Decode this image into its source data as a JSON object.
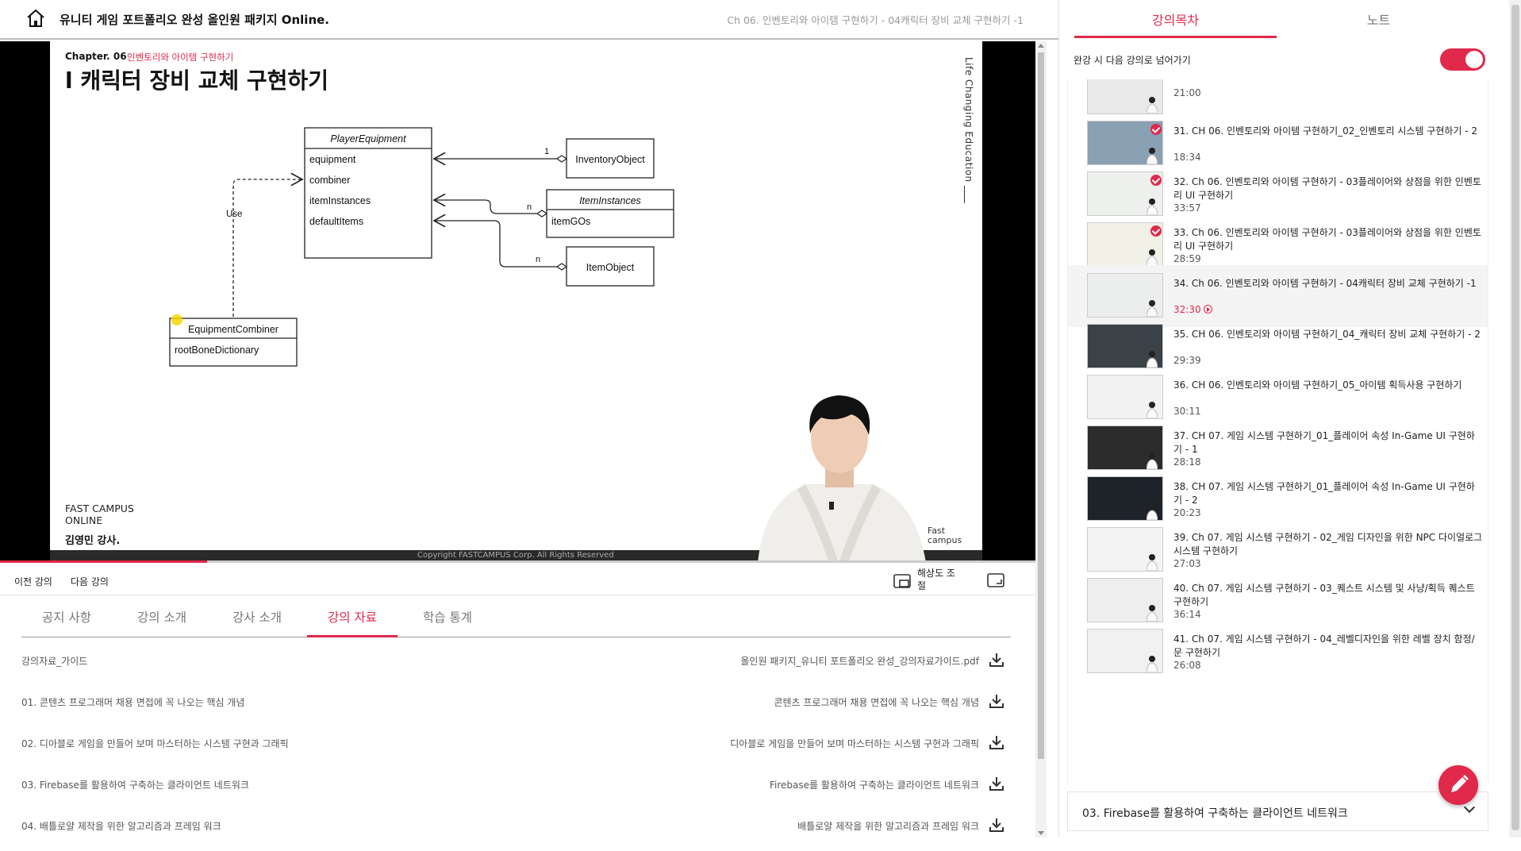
{
  "header": {
    "course_title": "유니티 게임 포트폴리오 완성 올인원 패키지 Online.",
    "lecture_title": "Ch 06. 인벤토리와 아이템 구현하기 - 04캐릭터 장비 교체 구현하기 -1",
    "home_icon": "home-icon"
  },
  "video": {
    "slide": {
      "chapter_label": "Chapter. 06",
      "chapter_name": "인벤토리와 아이템 구현하기",
      "heading": "l 캐릭터 장비 교체 구현하기",
      "side_text": "Life Changing Education",
      "brand_line1": "FAST CAMPUS",
      "brand_line2": "ONLINE",
      "instructor": "김영민 강사.",
      "brand_right1": "Fast",
      "brand_right2": "campus",
      "copyright": "Copyright FASTCAMPUS Corp. All Rights Reserved"
    },
    "diagram": {
      "player_equipment": {
        "title": "PlayerEquipment",
        "fields": [
          "equipment",
          "combiner",
          "itemInstances",
          "defaultItems"
        ]
      },
      "inventory_object": "InventoryObject",
      "item_instances": {
        "title": "ItemInstances",
        "fields": [
          "itemGOs"
        ]
      },
      "item_object": "ItemObject",
      "equipment_combiner": {
        "title": "EquipmentCombiner",
        "fields": [
          "rootBoneDictionary"
        ]
      },
      "use_label": "Use",
      "mult_1": "1",
      "mult_n1": "n",
      "mult_n2": "n"
    },
    "progress": 0.2
  },
  "controls": {
    "prev": "이전 강의",
    "next": "다음 강의",
    "resolution": "해상도 조절",
    "resolution_icon": "pip-icon",
    "fullscreen_icon": "fullscreen-icon"
  },
  "tabs": [
    {
      "label": "공지 사항",
      "active": false
    },
    {
      "label": "강의 소개",
      "active": false
    },
    {
      "label": "강사 소개",
      "active": false
    },
    {
      "label": "강의 자료",
      "active": true
    },
    {
      "label": "학습 통계",
      "active": false
    }
  ],
  "materials": [
    {
      "left": "강의자료_가이드",
      "right": "올인원 패키지_유니티 포트폴리오 완성_강의자료가이드.pdf"
    },
    {
      "left": "01. 콘텐츠 프로그래머 채용 면접에 꼭 나오는 핵심 개념",
      "right": "콘텐츠 프로그래머 채용 면접에 꼭 나오는 핵심 개념"
    },
    {
      "left": "02. 디아블로 게임을 만들어 보며 마스터하는 시스템 구현과 그래픽",
      "right": "디아블로 게임을 만들어 보며 마스터하는 시스템 구현과 그래픽"
    },
    {
      "left": "03. Firebase를 활용하여 구축하는 클라이언트 네트워크",
      "right": "Firebase를 활용하여 구축하는 클라이언트 네트워크"
    },
    {
      "left": "04. 배틀로얄 제작을 위한 알고리즘과 프레임 워크",
      "right": "배틀로얄 제작을 위한 알고리즘과 프레임 워크"
    }
  ],
  "rpanel": {
    "tabs": [
      {
        "label": "강의목차",
        "active": true
      },
      {
        "label": "노트",
        "active": false
      }
    ],
    "autoplay_label": "완강 시 다음 강의로 넘어가기",
    "autoplay_on": true,
    "items": [
      {
        "title": "",
        "duration": "21:00",
        "done": false,
        "current": false
      },
      {
        "title": "31. CH 06. 인벤토리와 아이템 구현하기_02_인벤토리 시스템 구현하기 - 2",
        "duration": "18:34",
        "done": true,
        "current": false
      },
      {
        "title": "32. Ch 06. 인벤토리와 아이템 구현하기 - 03플레이어와 상점을 위한 인벤토리 UI 구현하기",
        "duration": "33:57",
        "done": true,
        "current": false
      },
      {
        "title": "33. Ch 06. 인벤토리와 아이템 구현하기 - 03플레이어와 상점을 위한 인벤토리 UI 구현하기",
        "duration": "28:59",
        "done": true,
        "current": false
      },
      {
        "title": "34. Ch 06. 인벤토리와 아이템 구현하기 - 04캐릭터 장비 교체 구현하기 -1",
        "duration": "32:30",
        "done": false,
        "current": true
      },
      {
        "title": "35. CH 06. 인벤토리와 아이템 구현하기_04_캐릭터 장비 교체 구현하기 - 2",
        "duration": "29:39",
        "done": false,
        "current": false
      },
      {
        "title": "36. CH 06. 인벤토리와 아이템 구현하기_05_아이템 획득사용 구현하기",
        "duration": "30:11",
        "done": false,
        "current": false
      },
      {
        "title": "37. CH 07. 게임 시스템 구현하기_01_플레이어 속성 In-Game UI 구현하기 - 1",
        "duration": "28:18",
        "done": false,
        "current": false
      },
      {
        "title": "38. CH 07. 게임 시스템 구현하기_01_플레이어 속성 In-Game UI 구현하기 - 2",
        "duration": "20:23",
        "done": false,
        "current": false
      },
      {
        "title": "39. Ch 07. 게임 시스템 구현하기 - 02_게임 디자인을 위한 NPC 다이얼로그 시스템 구현하기",
        "duration": "27:03",
        "done": false,
        "current": false
      },
      {
        "title": "40. Ch 07. 게임 시스템 구현하기 - 03_퀘스트 시스템 및 사냥/획득 퀘스트 구현하기",
        "duration": "36:14",
        "done": false,
        "current": false
      },
      {
        "title": "41. Ch 07. 게임 시스템 구현하기 - 04_레벨디자인을 위한 레벨 장치 함정/문 구현하기",
        "duration": "26:08",
        "done": false,
        "current": false
      }
    ],
    "section_title": "03. Firebase를 활용하여 구축하는 클라이언트 네트워크",
    "fab_icon": "pencil-icon"
  },
  "colors": {
    "accent": "#e0294b"
  }
}
